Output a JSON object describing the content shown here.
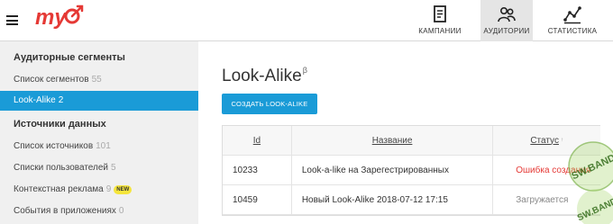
{
  "header": {
    "menu_icon": "hamburger-icon",
    "logo_text": "my",
    "nav": [
      {
        "label": "КАМПАНИИ",
        "icon": "campaigns-document-icon",
        "active": false
      },
      {
        "label": "АУДИТОРИИ",
        "icon": "audience-people-icon",
        "active": true
      },
      {
        "label": "СТАТИСТИКА",
        "icon": "statistics-chart-icon",
        "active": false
      }
    ]
  },
  "sidebar": {
    "section1": "Аудиторные сегменты",
    "items1": [
      {
        "label": "Список сегментов",
        "count": "55",
        "active": false
      },
      {
        "label": "Look-Alike",
        "count": "2",
        "active": true
      }
    ],
    "section2": "Источники данных",
    "items2": [
      {
        "label": "Список источников",
        "count": "101"
      },
      {
        "label": "Списки пользователей",
        "count": "5"
      },
      {
        "label": "Контекстная реклама",
        "count": "9",
        "badge": "NEW"
      },
      {
        "label": "События в приложениях",
        "count": "0"
      }
    ]
  },
  "main": {
    "title": "Look-Alike",
    "title_sup": "β",
    "create_button": "СОЗДАТЬ LOOK-ALIKE",
    "table": {
      "headers": {
        "id": "Id",
        "name": "Название",
        "status": "Статус",
        "status_sup": "↑"
      },
      "rows": [
        {
          "id": "10233",
          "name": "Look-a-like на Зарегестрированных",
          "status": "Ошибка создания",
          "status_type": "error"
        },
        {
          "id": "10459",
          "name": "Новый Look-Alike 2018-07-12 17:15",
          "status": "Загружается",
          "status_type": "loading"
        }
      ]
    }
  },
  "watermark": {
    "text_top": "SW.BAND",
    "text_bottom": "SW.BAND"
  },
  "colors": {
    "accent": "#1a9bd7",
    "logo": "#e53935",
    "error": "#e53935",
    "badge": "#f5e53c"
  }
}
